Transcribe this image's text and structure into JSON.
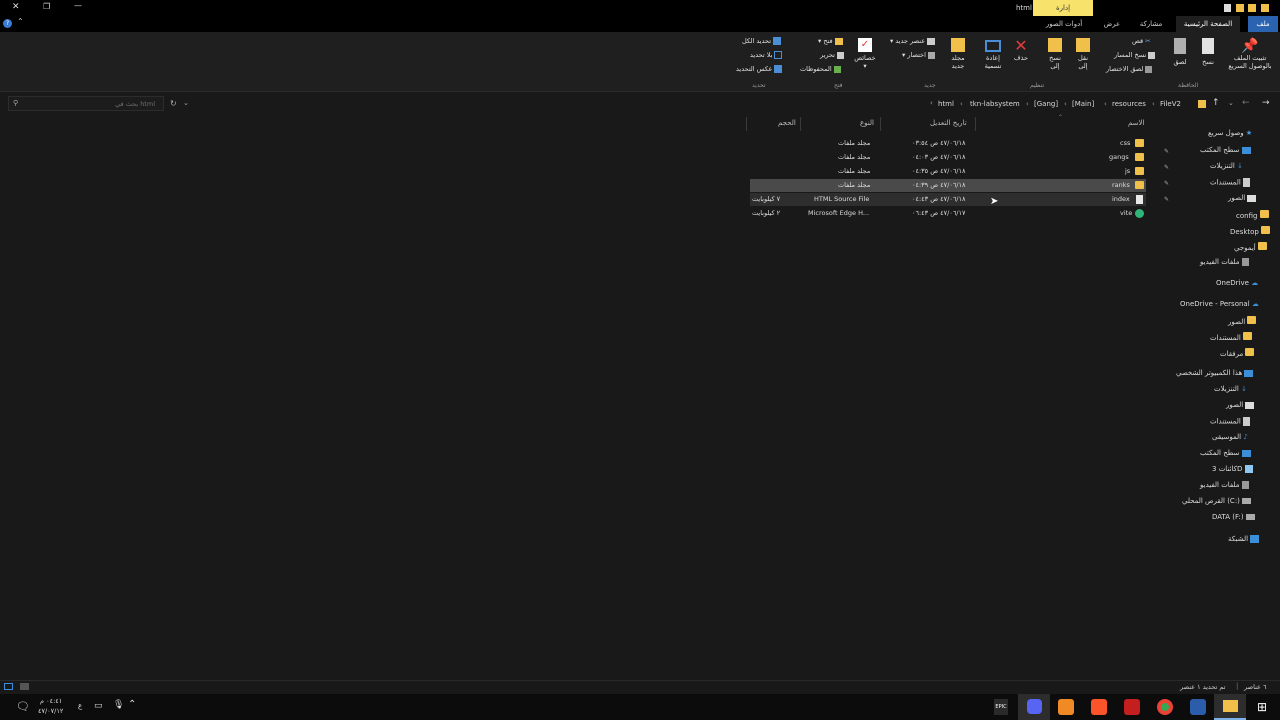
{
  "titlebar": {
    "context_tab": "إدارة",
    "title": "html"
  },
  "ribbon_tabs": {
    "file": "ملف",
    "home": "الصفحة الرئيسية",
    "share": "مشاركة",
    "view": "عرض",
    "picture_tools": "أدوات الصور"
  },
  "ribbon": {
    "pin": "تثبيت الملف\nبالوصول السريع",
    "copy": "نسخ",
    "paste": "لصق",
    "cut": "قص",
    "copy_path": "نسخ المسار",
    "paste_shortcut": "لصق الاختصار",
    "clipboard_group": "الحافظة",
    "move_to": "نقل\nإلى",
    "copy_to": "نسخ\nإلى",
    "delete": "حذف",
    "rename": "إعادة\nتسمية",
    "organize_group": "تنظيم",
    "new_folder": "مجلد\nجديد",
    "new_item": "عنصر جديد",
    "easy_access": "اختصار",
    "new_group": "جديد",
    "properties": "خصائص",
    "open": "فتح",
    "edit": "تحرير",
    "history": "المحفوظات",
    "open_group": "فتح",
    "select_all": "تحديد الكل",
    "select_none": "بلا تحديد",
    "invert_selection": "عكس التحديد",
    "select_group": "تحديد"
  },
  "address": {
    "crumbs": [
      "FileV2",
      "resources",
      "[Main]",
      "[Gang]",
      "tkn-labsystem",
      "html"
    ],
    "search_placeholder": "بحث في html"
  },
  "columns": {
    "name": "الاسم",
    "modified": "تاريخ التعديل",
    "type": "النوع",
    "size": "الحجم"
  },
  "files": [
    {
      "name": "css",
      "modified": "٤٧/٠٦/١٨ ص ٠٣:٥٤",
      "type": "مجلد ملفات",
      "size": "",
      "kind": "folder"
    },
    {
      "name": "gangs",
      "modified": "٤٧/٠٦/١٨ ص ٠٤:٠٣",
      "type": "مجلد ملفات",
      "size": "",
      "kind": "folder"
    },
    {
      "name": "js",
      "modified": "٤٧/٠٦/١٨ ص ٠٤:٣٥",
      "type": "مجلد ملفات",
      "size": "",
      "kind": "folder"
    },
    {
      "name": "ranks",
      "modified": "٤٧/٠٦/١٨ ص ٠٤:٣٩",
      "type": "مجلد ملفات",
      "size": "",
      "kind": "folder"
    },
    {
      "name": "index",
      "modified": "٤٧/٠٦/١٨ ص ٠٤:٤٣",
      "type": "HTML Source File",
      "size": "٧ كيلوبايت",
      "kind": "file"
    },
    {
      "name": "vite",
      "modified": "٤٧/٠٦/١٧ ص ٠٦:٤٣",
      "type": "Microsoft Edge H...",
      "size": "٢ كيلوبايت",
      "kind": "edge"
    }
  ],
  "nav": {
    "quick_access": "وصول سريع",
    "items": [
      {
        "label": "سطح المكتب",
        "pinned": true
      },
      {
        "label": "التنزيلات",
        "pinned": true
      },
      {
        "label": "المستندات",
        "pinned": true
      },
      {
        "label": "الصور",
        "pinned": true
      },
      {
        "label": "config",
        "pinned": false
      },
      {
        "label": "Desktop",
        "pinned": false
      },
      {
        "label": "أيموجي",
        "pinned": false
      },
      {
        "label": "ملفات الفيديو",
        "pinned": false
      }
    ],
    "onedrive": "OneDrive",
    "onedrive_personal": "OneDrive - Personal",
    "od_items": [
      "الصور",
      "المستندات",
      "مرفقات"
    ],
    "this_pc": "هذا الكمبيوتر الشخصي",
    "pc_items": [
      "التنزيلات",
      "الصور",
      "المستندات",
      "الموسيقى",
      "سطح المكتب",
      "كائنات 3D",
      "ملفات الفيديو",
      "القرص المحلي (C:)",
      "DATA (F:)"
    ],
    "network": "الشبكة"
  },
  "status": {
    "left": "٦ عناصر",
    "sep": "|",
    "right": "تم تحديد ١ عنصر"
  },
  "taskbar": {
    "time": "٠٤:٤١ م",
    "date": "٤٧/٠٧/١٢",
    "lang": "ع"
  }
}
